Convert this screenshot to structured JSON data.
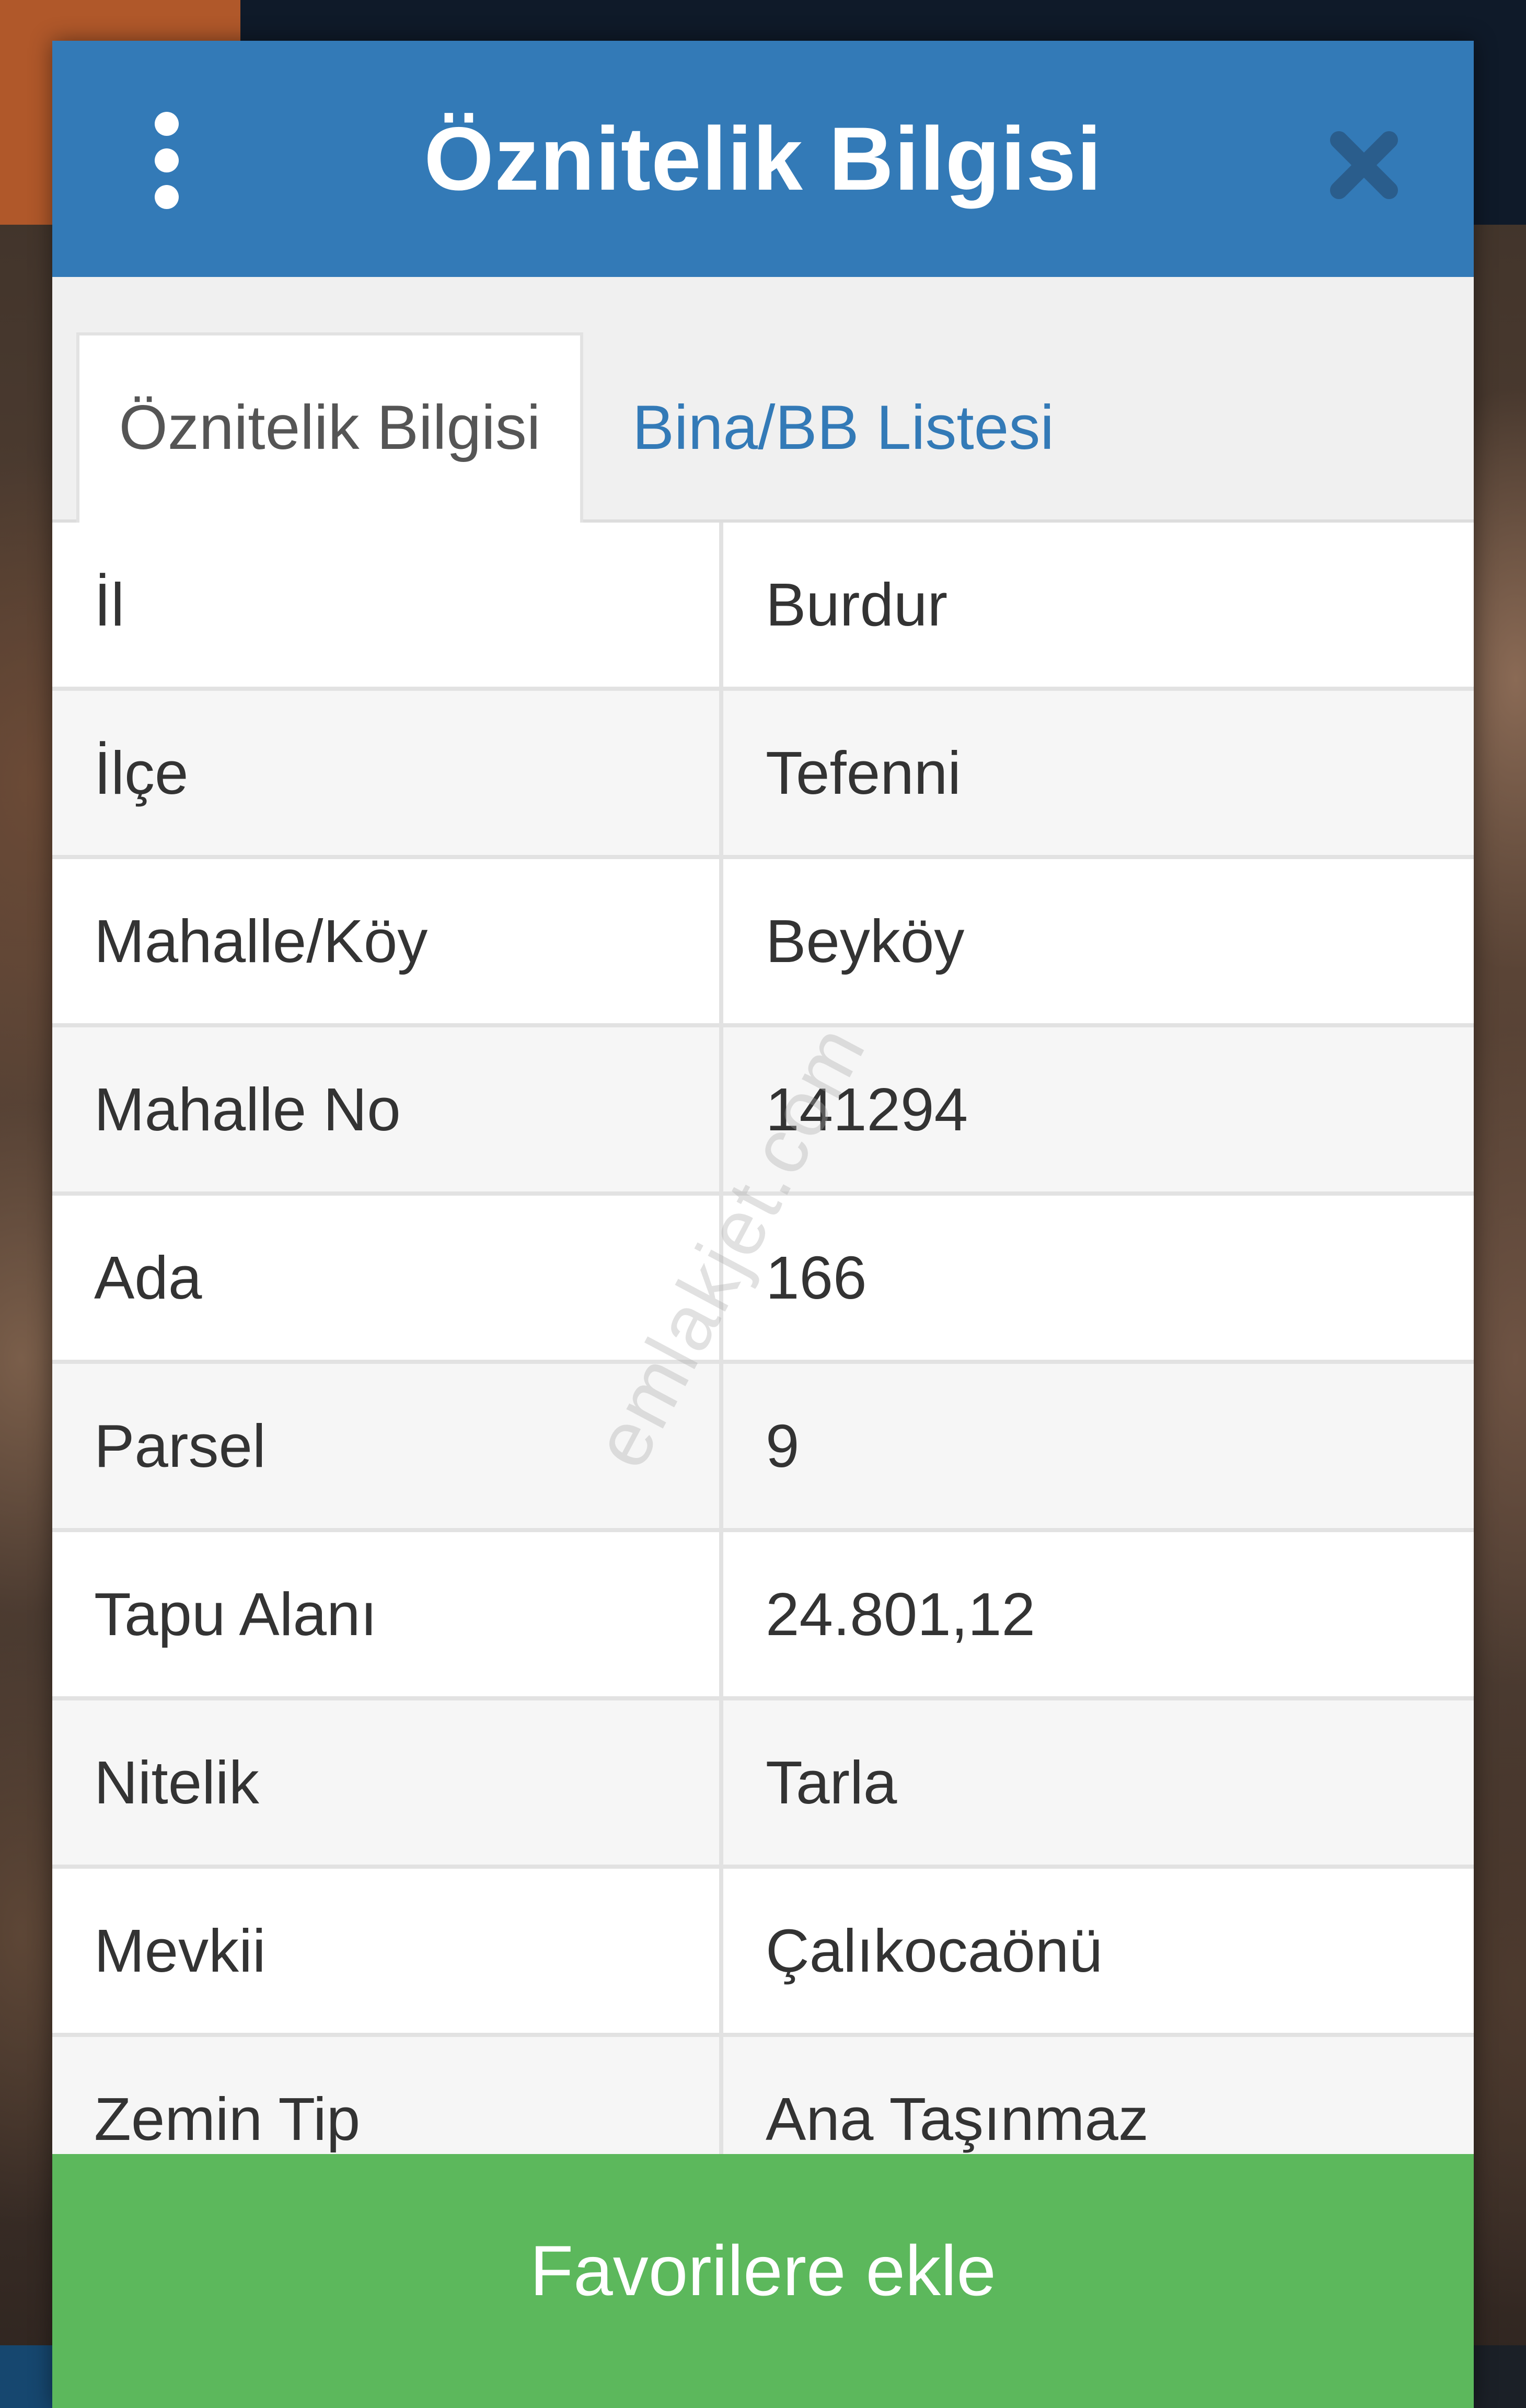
{
  "dialog": {
    "title": "Öznitelik Bilgisi",
    "menu_icon": "vertical-dots-icon",
    "close_icon": "close-icon"
  },
  "tabs": [
    {
      "label": "Öznitelik Bilgisi",
      "active": true
    },
    {
      "label": "Bina/BB Listesi",
      "active": false
    }
  ],
  "attributes": [
    {
      "key": "İl",
      "value": "Burdur"
    },
    {
      "key": "İlçe",
      "value": "Tefenni"
    },
    {
      "key": "Mahalle/Köy",
      "value": "Beyköy"
    },
    {
      "key": "Mahalle No",
      "value": "141294"
    },
    {
      "key": "Ada",
      "value": "166"
    },
    {
      "key": "Parsel",
      "value": "9"
    },
    {
      "key": "Tapu Alanı",
      "value": "24.801,12"
    },
    {
      "key": "Nitelik",
      "value": "Tarla"
    },
    {
      "key": "Mevkii",
      "value": "Çalıkocaönü"
    },
    {
      "key": "Zemin Tip",
      "value": "Ana Taşınmaz"
    }
  ],
  "watermark": "emlakjet.com",
  "footer": {
    "button_label": "Favorilere ekle"
  },
  "colors": {
    "header": "#337ab7",
    "tab_link": "#337ab7",
    "favorite_button": "#5cb85c",
    "close_icon": "#2a5d8c"
  }
}
